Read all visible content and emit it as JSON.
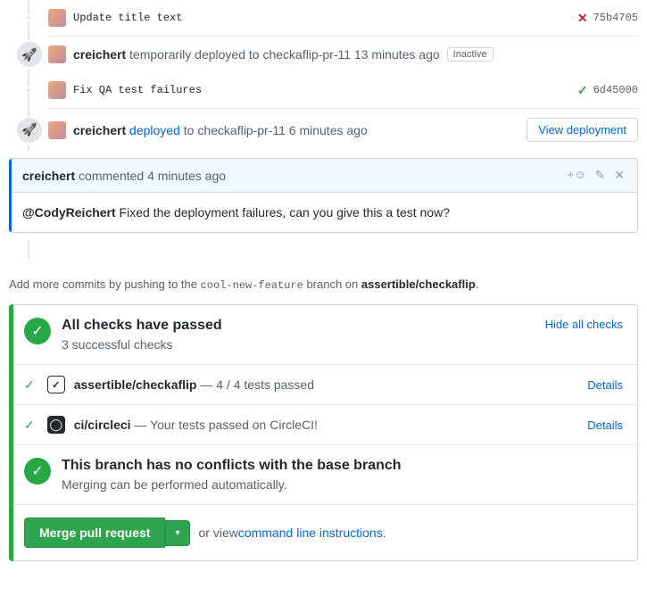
{
  "timeline": {
    "commit1": {
      "msg": "Update title text",
      "sha": "75b4705",
      "status": "fail"
    },
    "deploy1": {
      "author": "creichert",
      "verb": "temporarily deployed to",
      "target": "checkaflip-pr-11",
      "time": "13 minutes ago",
      "badge": "Inactive"
    },
    "commit2": {
      "msg": "Fix QA test failures",
      "sha": "6d45000",
      "status": "pass"
    },
    "deploy2": {
      "author": "creichert",
      "verb_link": "deployed",
      "rest": "to checkaflip-pr-11 6 minutes ago",
      "button": "View deployment"
    }
  },
  "comment": {
    "author": "creichert",
    "verb": "commented",
    "time": "4 minutes ago",
    "mention": "@CodyReichert",
    "body_rest": " Fixed the deployment failures, can you give this a test now?"
  },
  "push_hint": {
    "prefix": "Add more commits by pushing to the ",
    "branch": "cool-new-feature",
    "middle": " branch on ",
    "repo": "assertible/checkaflip",
    "suffix": "."
  },
  "checks": {
    "title": "All checks have passed",
    "sub": "3 successful checks",
    "hide": "Hide all checks",
    "rows": [
      {
        "service": "assertible/checkaflip",
        "detail": " — 4 / 4 tests passed",
        "link": "Details"
      },
      {
        "service": "ci/circleci",
        "detail": " — Your tests passed on CircleCI!",
        "link": "Details"
      }
    ],
    "merge_title": "This branch has no conflicts with the base branch",
    "merge_sub": "Merging can be performed automatically."
  },
  "footer": {
    "merge_btn": "Merge pull request",
    "or_view": " or view ",
    "cli_link": "command line instructions",
    "dot": "."
  }
}
